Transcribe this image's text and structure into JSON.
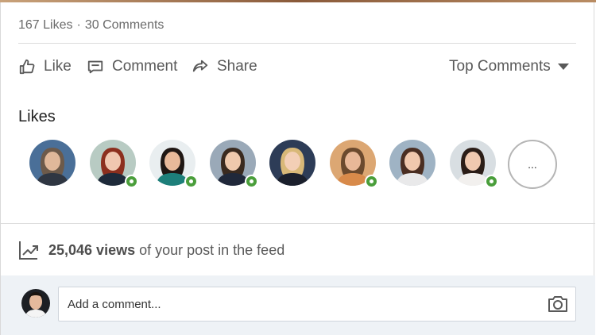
{
  "stats": {
    "likes": "167 Likes",
    "separator": "·",
    "comments": "30 Comments"
  },
  "actions": {
    "like_label": "Like",
    "comment_label": "Comment",
    "share_label": "Share",
    "sort_label": "Top Comments"
  },
  "likes": {
    "title": "Likes",
    "more_label": "...",
    "avatars": [
      {
        "name": "liker-1",
        "online": false,
        "bg": "#4a6f98",
        "skin": "#e0b89a",
        "hair": "#6d5a4a",
        "shirt": "#2f3642"
      },
      {
        "name": "liker-2",
        "online": true,
        "bg": "#b8cbc3",
        "skin": "#f0c7b0",
        "hair": "#8c2f1e",
        "shirt": "#1e2a3a"
      },
      {
        "name": "liker-3",
        "online": true,
        "bg": "#e9eef0",
        "skin": "#e8b99a",
        "hair": "#1f1714",
        "shirt": "#1d7f7a"
      },
      {
        "name": "liker-4",
        "online": true,
        "bg": "#9aa9b8",
        "skin": "#efc9ad",
        "hair": "#3a2a1f",
        "shirt": "#20283a"
      },
      {
        "name": "liker-5",
        "online": false,
        "bg": "#2d3c57",
        "skin": "#f3cfb6",
        "hair": "#d8b878",
        "shirt": "#1a1f2c"
      },
      {
        "name": "liker-6",
        "online": true,
        "bg": "#dca773",
        "skin": "#e8b898",
        "hair": "#6b4a2e",
        "shirt": "#d88a4a"
      },
      {
        "name": "liker-7",
        "online": false,
        "bg": "#9fb3c4",
        "skin": "#f0c8ad",
        "hair": "#4a2e22",
        "shirt": "#e9e9ea"
      },
      {
        "name": "liker-8",
        "online": true,
        "bg": "#d8dee2",
        "skin": "#f0c9b0",
        "hair": "#2b1d17",
        "shirt": "#f2f0ee"
      }
    ]
  },
  "views": {
    "count": "25,046 views",
    "suffix": "of your post in the feed"
  },
  "comment_box": {
    "placeholder": "Add a comment..."
  },
  "colors": {
    "online": "#4a9e3b",
    "comment_bg": "#eef2f6",
    "text_muted": "#6b6b6b"
  }
}
